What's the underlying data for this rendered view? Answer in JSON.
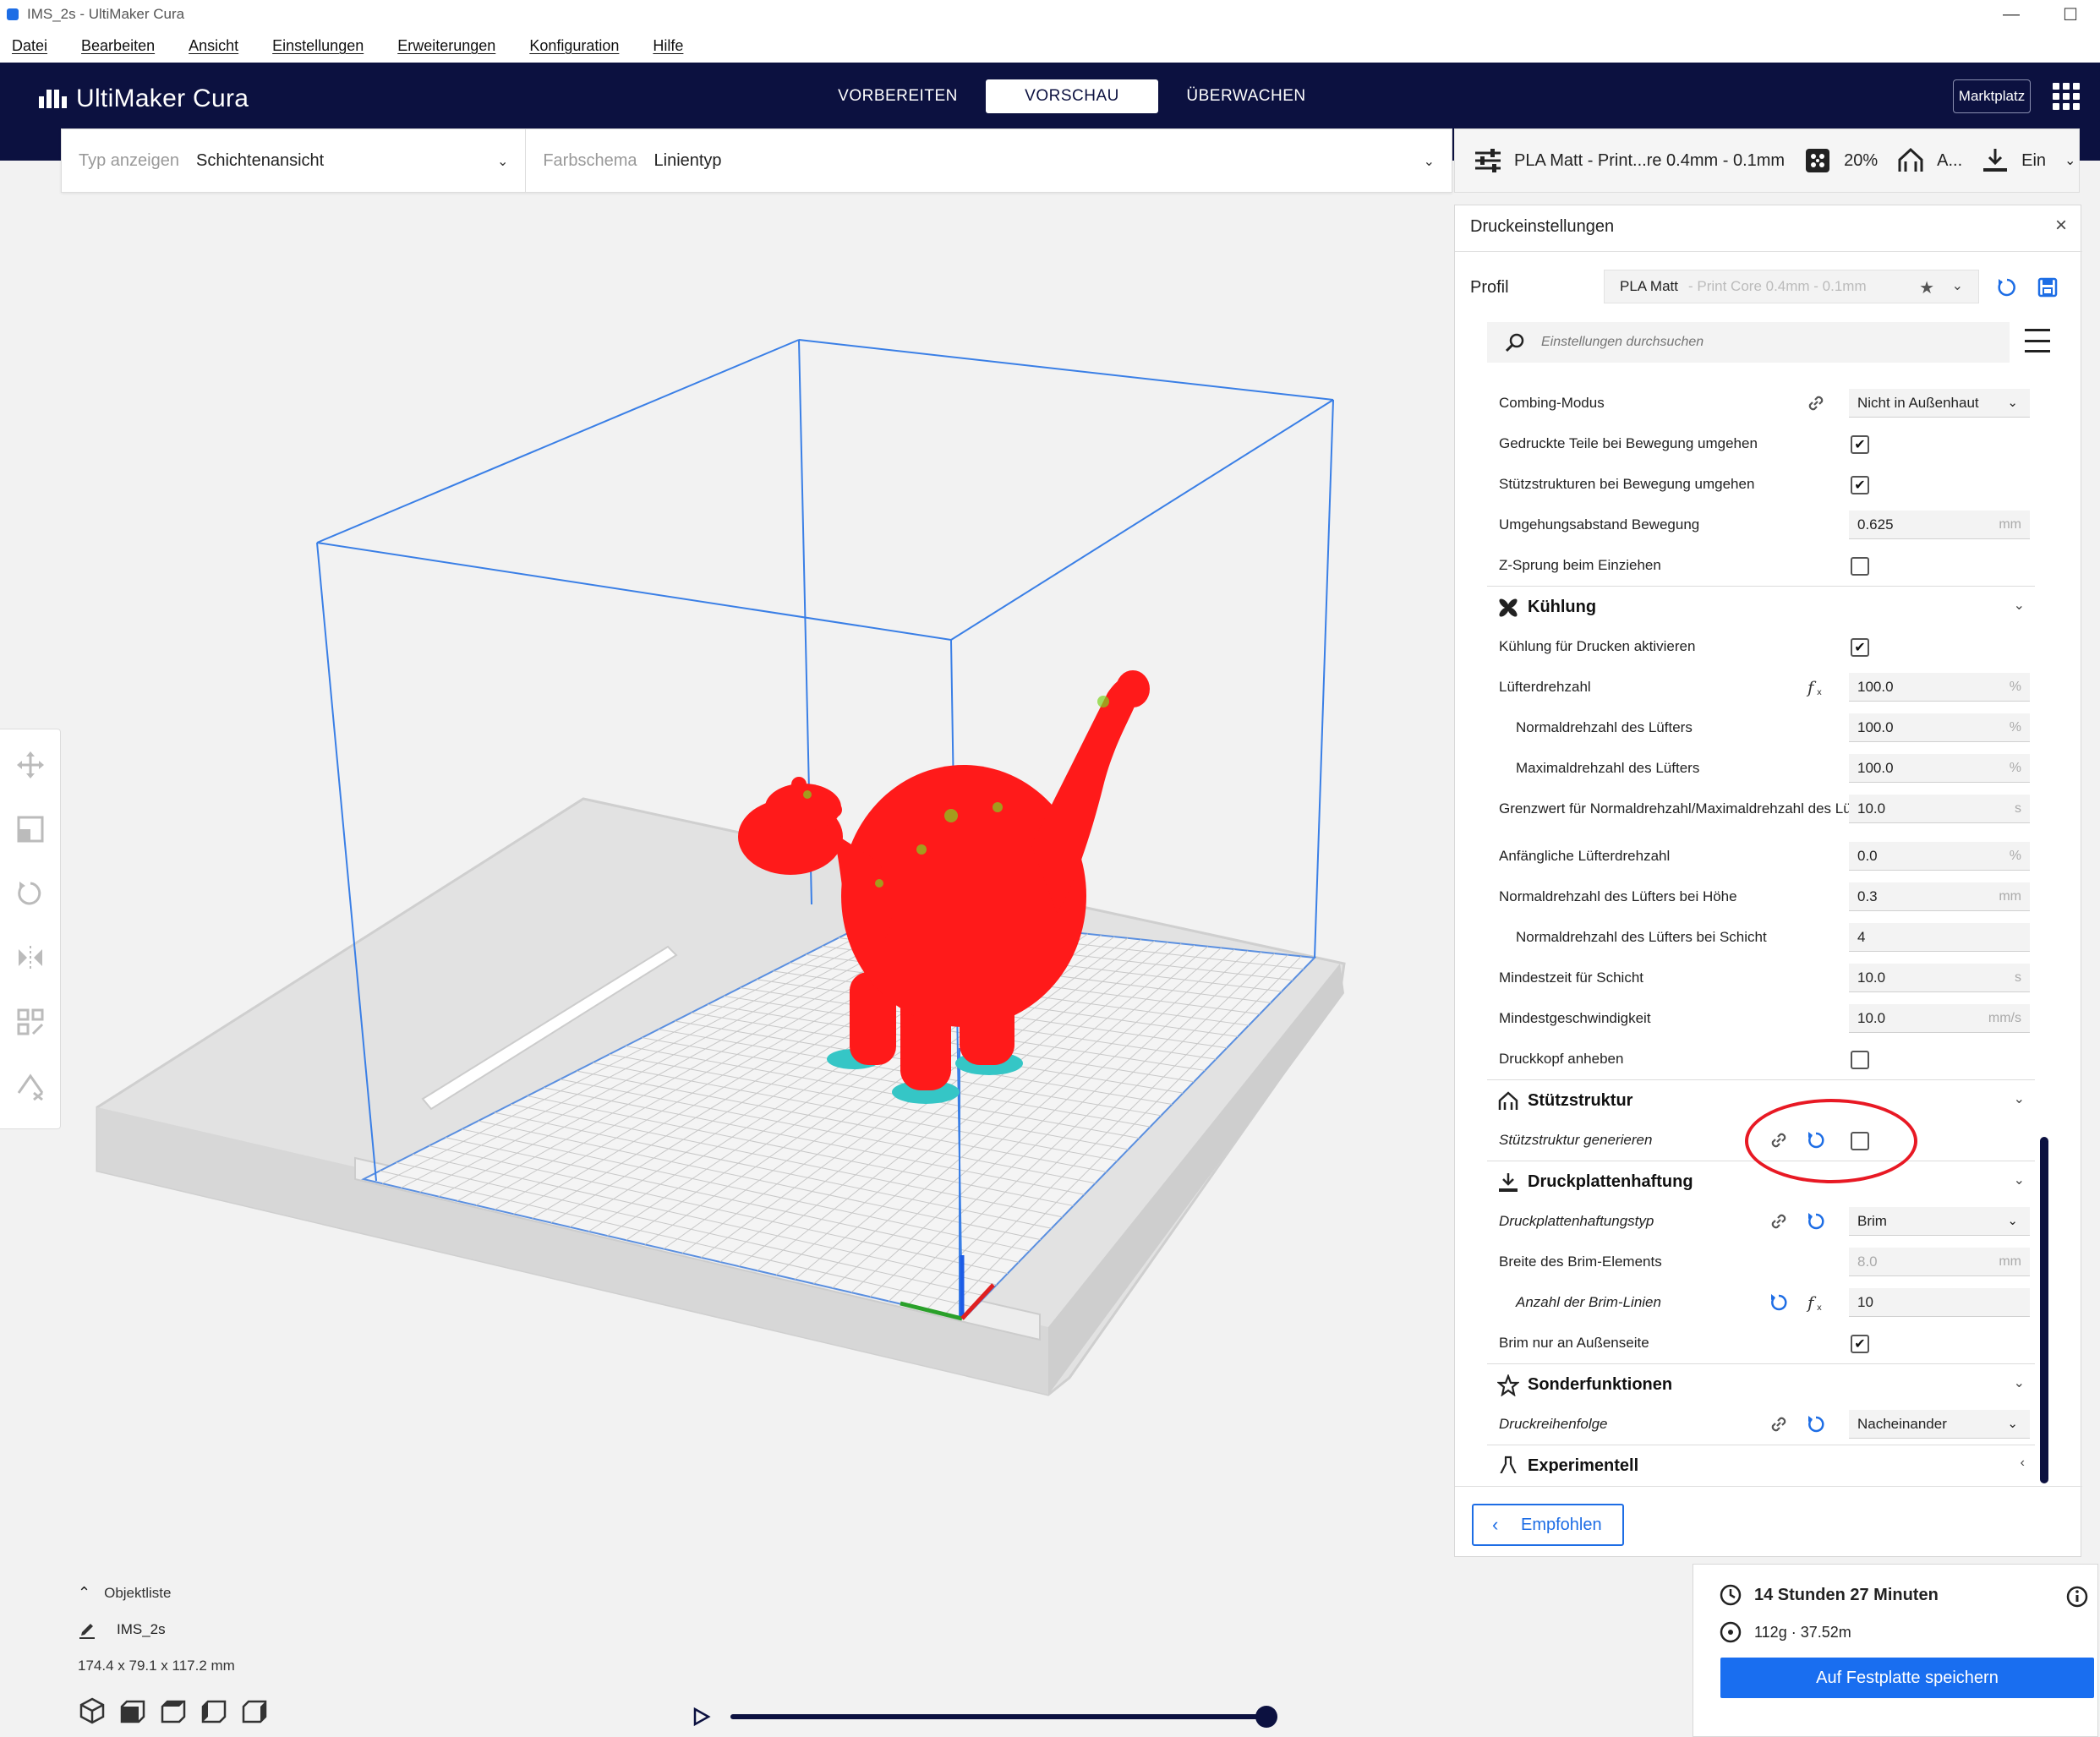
{
  "window": {
    "title": "IMS_2s - UltiMaker Cura",
    "min": "—",
    "max": "☐"
  },
  "menu": [
    "Datei",
    "Bearbeiten",
    "Ansicht",
    "Einstellungen",
    "Erweiterungen",
    "Konfiguration",
    "Hilfe"
  ],
  "header": {
    "logo": "UltiMaker Cura",
    "stages": [
      "VORBEREITEN",
      "VORSCHAU",
      "ÜBERWACHEN"
    ],
    "active_stage": "VORSCHAU",
    "marketplace": "Marktplatz"
  },
  "viewbar": {
    "type_label": "Typ anzeigen",
    "type_value": "Schichtenansicht",
    "scheme_label": "Farbschema",
    "scheme_value": "Linientyp"
  },
  "printbar": {
    "profile": "PLA Matt - Print...re 0.4mm - 0.1mm",
    "infill": "20%",
    "support": "A...",
    "adhesion": "Ein"
  },
  "panel": {
    "title": "Druckeinstellungen",
    "profile_label": "Profil",
    "profile_name": "PLA Matt",
    "profile_sub": "- Print Core 0.4mm - 0.1mm",
    "search_placeholder": "Einstellungen durchsuchen",
    "rows": [
      {
        "name": "Combing-Modus",
        "value": "Nicht in Außenhaut"
      },
      {
        "name": "Gedruckte Teile bei Bewegung umgehen"
      },
      {
        "name": "Stützstrukturen bei Bewegung umgehen"
      },
      {
        "name": "Umgehungsabstand Bewegung",
        "value": "0.625",
        "unit": "mm"
      },
      {
        "name": "Z-Sprung beim Einziehen"
      },
      {
        "category": "Kühlung"
      },
      {
        "name": "Kühlung für Drucken aktivieren"
      },
      {
        "name": "Lüfterdrehzahl",
        "value": "100.0",
        "unit": "%"
      },
      {
        "name": "Normaldrehzahl des Lüfters",
        "value": "100.0",
        "unit": "%"
      },
      {
        "name": "Maximaldrehzahl des Lüfters",
        "value": "100.0",
        "unit": "%"
      },
      {
        "name": "Grenzwert für Normaldrehzahl/Maximaldrehzahl des Lüfters",
        "value": "10.0",
        "unit": "s"
      },
      {
        "name": "Anfängliche Lüfterdrehzahl",
        "value": "0.0",
        "unit": "%"
      },
      {
        "name": "Normaldrehzahl des Lüfters bei Höhe",
        "value": "0.3",
        "unit": "mm"
      },
      {
        "name": "Normaldrehzahl des Lüfters bei Schicht",
        "value": "4"
      },
      {
        "name": "Mindestzeit für Schicht",
        "value": "10.0",
        "unit": "s"
      },
      {
        "name": "Mindestgeschwindigkeit",
        "value": "10.0",
        "unit": "mm/s"
      },
      {
        "name": "Druckkopf anheben"
      },
      {
        "category": "Stützstruktur"
      },
      {
        "name": "Stützstruktur generieren"
      },
      {
        "category": "Druckplattenhaftung"
      },
      {
        "name": "Druckplattenhaftungstyp",
        "value": "Brim"
      },
      {
        "name": "Breite des Brim-Elements",
        "value": "8.0",
        "unit": "mm"
      },
      {
        "name": "Anzahl der Brim-Linien",
        "value": "10"
      },
      {
        "name": "Brim nur an Außenseite"
      },
      {
        "category": "Sonderfunktionen"
      },
      {
        "name": "Druckreihenfolge",
        "value": "Nacheinander"
      },
      {
        "category": "Experimentell"
      }
    ],
    "recommended_button": "Empfohlen"
  },
  "output": {
    "time": "14 Stunden 27 Minuten",
    "material": "112g · 37.52m",
    "save": "Auf Festplatte speichern"
  },
  "objects": {
    "title": "Objektliste",
    "item": "IMS_2s",
    "dims": "174.4 x 79.1 x 117.2 mm"
  },
  "colors": {
    "header": "#0c1140",
    "accent": "#196ef0",
    "model": "#ff1a1a",
    "annotation": "#e81924"
  }
}
